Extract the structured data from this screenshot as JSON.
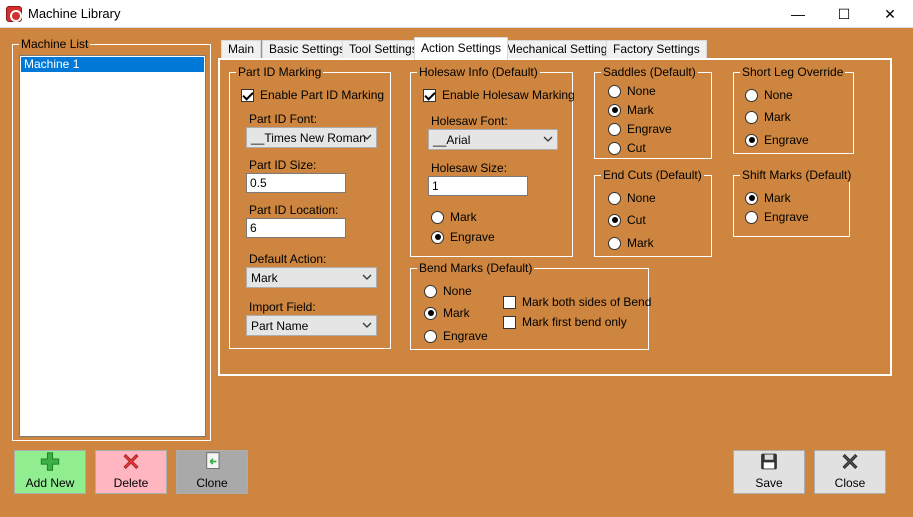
{
  "window": {
    "title": "Machine Library",
    "minimize_glyph": "—",
    "maximize_glyph": "☐",
    "close_glyph": "✕"
  },
  "machine_list": {
    "title": "Machine List",
    "items": [
      "Machine 1"
    ],
    "selected": "Machine 1"
  },
  "tabs": [
    {
      "label": "Main"
    },
    {
      "label": "Basic Settings"
    },
    {
      "label": "Tool Settings"
    },
    {
      "label": "Action Settings",
      "active": true
    },
    {
      "label": "Mechanical Settings"
    },
    {
      "label": "Factory Settings"
    }
  ],
  "part_id": {
    "title": "Part ID Marking",
    "enable_label": "Enable Part ID Marking",
    "enable_checked": true,
    "font_label": "Part ID Font:",
    "font_value": "__Times New Roman",
    "size_label": "Part ID Size:",
    "size_value": "0.5",
    "location_label": "Part ID Location:",
    "location_value": "6",
    "default_action_label": "Default Action:",
    "default_action_value": "Mark",
    "import_field_label": "Import Field:",
    "import_field_value": "Part Name"
  },
  "holesaw": {
    "title": "Holesaw Info (Default)",
    "enable_label": "Enable Holesaw Marking",
    "enable_checked": true,
    "font_label": "Holesaw Font:",
    "font_value": "__Arial",
    "size_label": "Holesaw Size:",
    "size_value": "1",
    "options": [
      "Mark",
      "Engrave"
    ],
    "selected": "Engrave"
  },
  "saddles": {
    "title": "Saddles (Default)",
    "options": [
      "None",
      "Mark",
      "Engrave",
      "Cut"
    ],
    "selected": "Mark"
  },
  "end_cuts": {
    "title": "End Cuts (Default)",
    "options": [
      "None",
      "Cut",
      "Mark"
    ],
    "selected": "Cut"
  },
  "short_leg": {
    "title": "Short Leg Override",
    "options": [
      "None",
      "Mark",
      "Engrave"
    ],
    "selected": "Engrave"
  },
  "shift_marks": {
    "title": "Shift Marks (Default)",
    "options": [
      "Mark",
      "Engrave"
    ],
    "selected": "Mark"
  },
  "bend_marks": {
    "title": "Bend Marks (Default)",
    "options": [
      "None",
      "Mark",
      "Engrave"
    ],
    "selected": "Mark",
    "both_sides_label": "Mark both sides of Bend",
    "both_sides_checked": false,
    "first_only_label": "Mark first bend only",
    "first_only_checked": false
  },
  "buttons": {
    "add_new": "Add New",
    "delete": "Delete",
    "clone": "Clone",
    "save": "Save",
    "close": "Close"
  },
  "colors": {
    "background": "#cd853f",
    "selection": "#0078d7",
    "add_button_bg": "#90ee90",
    "delete_button_bg": "#ffb6c1",
    "clone_button_bg": "#a9a9a9",
    "neutral_button_bg": "#e1e1e1"
  }
}
